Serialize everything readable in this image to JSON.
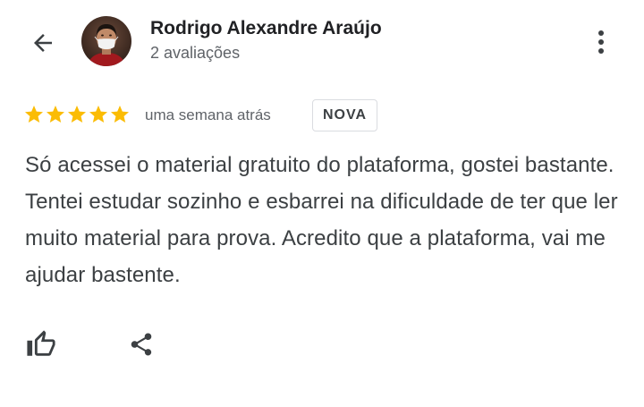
{
  "header": {
    "author_name": "Rodrigo Alexandre Araújo",
    "review_count": "2 avaliações",
    "back_icon": "arrow-back-icon",
    "more_icon": "more-vert-icon"
  },
  "review": {
    "rating": 5,
    "rating_max": 5,
    "time": "uma semana atrás",
    "badge": "NOVA",
    "text": "Só acessei o material gratuito do plataforma, gostei bastante. Tentei estudar sozinho e esbarrei na dificuldade de ter que ler muito material para prova. Acredito que a plataforma, vai me ajudar bastente."
  },
  "actions": {
    "like_icon": "thumb-up-icon",
    "share_icon": "share-icon"
  },
  "colors": {
    "star": "#fbbc04",
    "text_primary": "#202124",
    "text_secondary": "#5f6368",
    "icon": "#3c4043"
  }
}
